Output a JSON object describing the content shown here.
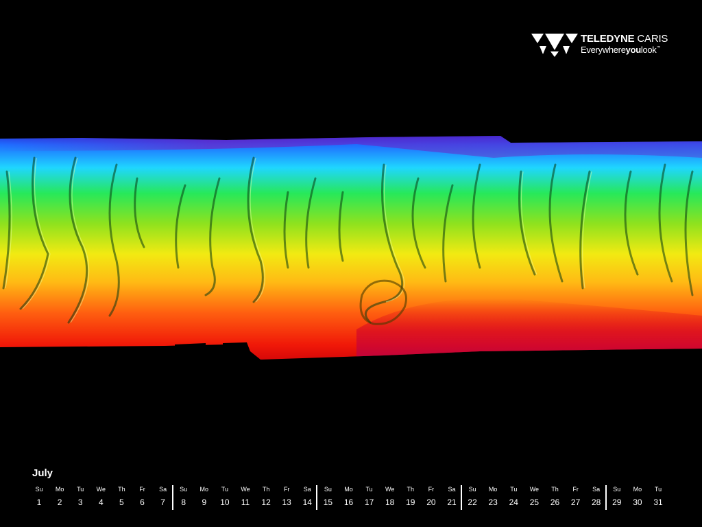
{
  "logo": {
    "brand_bold": "TELEDYNE",
    "brand_light": "CARIS",
    "tagline_a": "Everywhere",
    "tagline_b": "you",
    "tagline_c": "look",
    "tm": "™"
  },
  "calendar": {
    "month": "July",
    "days": [
      {
        "dow": "Su",
        "num": "1"
      },
      {
        "dow": "Mo",
        "num": "2"
      },
      {
        "dow": "Tu",
        "num": "3"
      },
      {
        "dow": "We",
        "num": "4"
      },
      {
        "dow": "Th",
        "num": "5"
      },
      {
        "dow": "Fr",
        "num": "6"
      },
      {
        "dow": "Sa",
        "num": "7"
      },
      {
        "dow": "Su",
        "num": "8"
      },
      {
        "dow": "Mo",
        "num": "9"
      },
      {
        "dow": "Tu",
        "num": "10"
      },
      {
        "dow": "We",
        "num": "11"
      },
      {
        "dow": "Th",
        "num": "12"
      },
      {
        "dow": "Fr",
        "num": "13"
      },
      {
        "dow": "Sa",
        "num": "14"
      },
      {
        "dow": "Su",
        "num": "15"
      },
      {
        "dow": "Mo",
        "num": "16"
      },
      {
        "dow": "Tu",
        "num": "17"
      },
      {
        "dow": "We",
        "num": "18"
      },
      {
        "dow": "Th",
        "num": "19"
      },
      {
        "dow": "Fr",
        "num": "20"
      },
      {
        "dow": "Sa",
        "num": "21"
      },
      {
        "dow": "Su",
        "num": "22"
      },
      {
        "dow": "Mo",
        "num": "23"
      },
      {
        "dow": "Tu",
        "num": "24"
      },
      {
        "dow": "We",
        "num": "25"
      },
      {
        "dow": "Th",
        "num": "26"
      },
      {
        "dow": "Fr",
        "num": "27"
      },
      {
        "dow": "Sa",
        "num": "28"
      },
      {
        "dow": "Su",
        "num": "29"
      },
      {
        "dow": "Mo",
        "num": "30"
      },
      {
        "dow": "Tu",
        "num": "31"
      }
    ]
  },
  "colors": {
    "background": "#000000",
    "text": "#ffffff",
    "depth_shallow": "#ff0000",
    "depth_mid": "#ffff00",
    "depth_green": "#00e000",
    "depth_cyan": "#00e0ff",
    "depth_deep": "#6000c0"
  }
}
